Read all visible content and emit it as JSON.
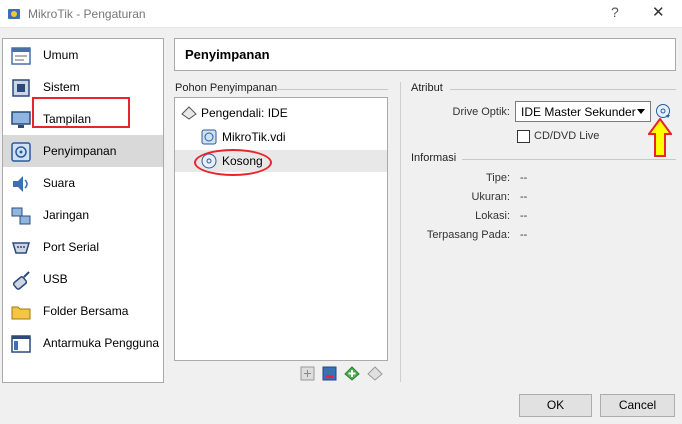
{
  "window": {
    "title": "MikroTik - Pengaturan",
    "help_glyph": "?",
    "close_glyph": "✕"
  },
  "sidebar": {
    "items": [
      {
        "label": "Umum",
        "icon": "general-icon"
      },
      {
        "label": "Sistem",
        "icon": "system-chip-icon"
      },
      {
        "label": "Tampilan",
        "icon": "display-monitor-icon"
      },
      {
        "label": "Penyimpanan",
        "icon": "storage-disk-icon",
        "active": true
      },
      {
        "label": "Suara",
        "icon": "speaker-icon"
      },
      {
        "label": "Jaringan",
        "icon": "network-icon"
      },
      {
        "label": "Port Serial",
        "icon": "serial-port-icon"
      },
      {
        "label": "USB",
        "icon": "usb-icon"
      },
      {
        "label": "Folder Bersama",
        "icon": "shared-folder-icon"
      },
      {
        "label": "Antarmuka Pengguna",
        "icon": "user-interface-icon"
      }
    ]
  },
  "section": {
    "title": "Penyimpanan"
  },
  "storage_tree": {
    "label": "Pohon Penyimpanan",
    "controller": {
      "label": "Pengendali: IDE",
      "icon": "ide-controller-icon"
    },
    "devices": [
      {
        "label": "MikroTik.vdi",
        "icon": "hard-disk-icon"
      },
      {
        "label": "Kosong",
        "icon": "optical-disc-icon",
        "selected": true
      }
    ],
    "tools": [
      "add-controller-icon",
      "remove-controller-icon",
      "add-attachment-icon",
      "remove-attachment-icon"
    ]
  },
  "attributes": {
    "label": "Atribut",
    "optical_drive_label": "Drive Optik:",
    "optical_drive_value": "IDE Master Sekunder",
    "live_cd_label": "CD/DVD Live",
    "live_cd_checked": false
  },
  "information": {
    "label": "Informasi",
    "rows": [
      {
        "label": "Tipe:",
        "value": "--"
      },
      {
        "label": "Ukuran:",
        "value": "--"
      },
      {
        "label": "Lokasi:",
        "value": "--"
      },
      {
        "label": "Terpasang Pada:",
        "value": "--"
      }
    ]
  },
  "buttons": {
    "ok": "OK",
    "cancel": "Cancel"
  },
  "colors": {
    "highlight_annotation": "#e8242d",
    "arrow_fill": "#ffff00",
    "arrow_stroke": "#e8242d",
    "selected_row": "#d9d9d9"
  }
}
